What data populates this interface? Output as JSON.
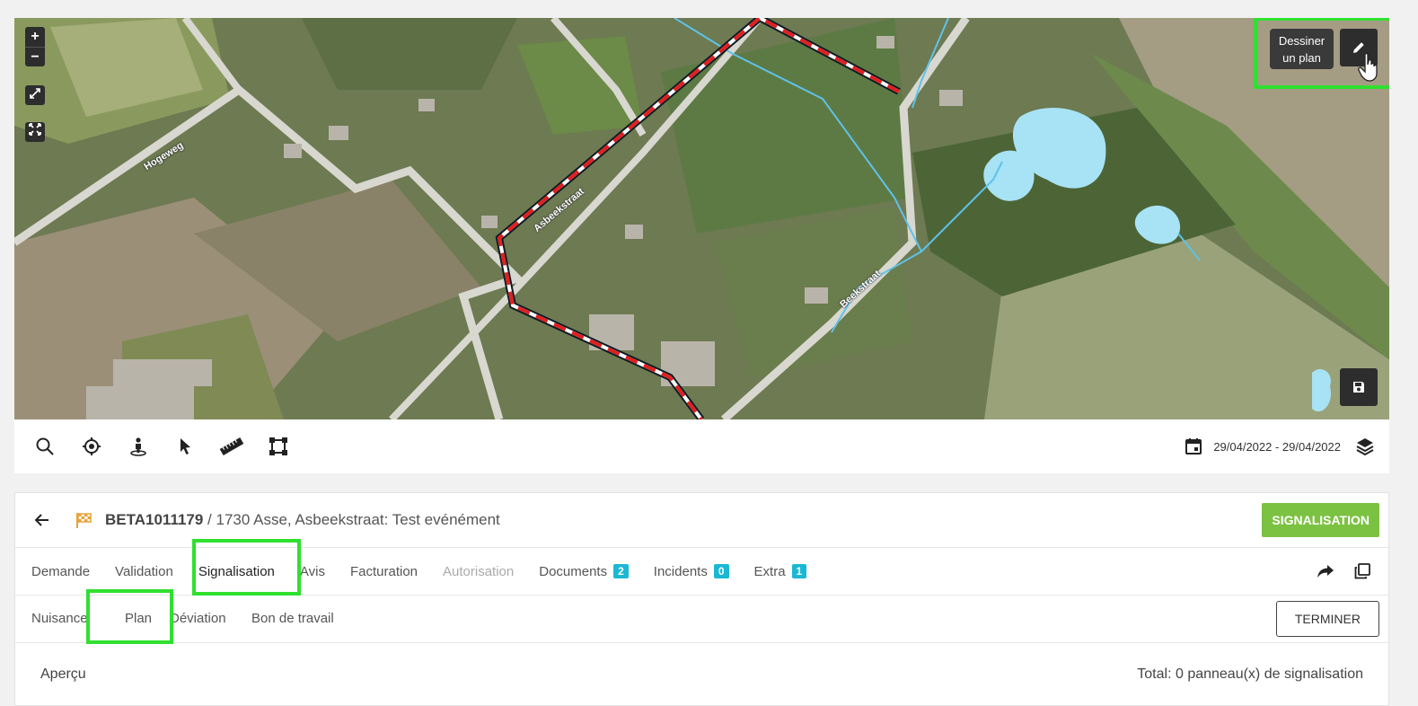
{
  "map": {
    "zoom_in": "+",
    "zoom_out": "−",
    "draw_tooltip_line1": "Dessiner",
    "draw_tooltip_line2": "un plan",
    "streets": [
      "Hogeweg",
      "Asbeekstraat",
      "Beekstraat"
    ]
  },
  "toolbar": {
    "tools": [
      "search-icon",
      "locate-icon",
      "streetview-icon",
      "select-cursor-icon",
      "ruler-icon",
      "draw-area-icon"
    ],
    "date_range": "29/04/2022 - 29/04/2022"
  },
  "panel": {
    "event_id": "BETA1011179",
    "event_title": " / 1730 Asse, Asbeekstraat: Test evénément",
    "status_button": "SIGNALISATION",
    "tabs": [
      {
        "label": "Demande"
      },
      {
        "label": "Validation"
      },
      {
        "label": "Signalisation"
      },
      {
        "label": "Avis"
      },
      {
        "label": "Facturation"
      },
      {
        "label": "Autorisation"
      },
      {
        "label": "Documents",
        "badge": "2"
      },
      {
        "label": "Incidents",
        "badge": "0"
      },
      {
        "label": "Extra",
        "badge": "1"
      }
    ],
    "subtabs": [
      "Nuisance",
      "Plan",
      "Déviation",
      "Bon de travail"
    ],
    "finish_button": "TERMINER",
    "overview_label": "Aperçu",
    "overview_total": "Total: 0 panneau(x) de signalisation"
  },
  "colors": {
    "accent_green": "#7cc242",
    "badge_blue": "#1ab8d4",
    "highlight": "#2fe02f",
    "route_red": "#e02020"
  }
}
